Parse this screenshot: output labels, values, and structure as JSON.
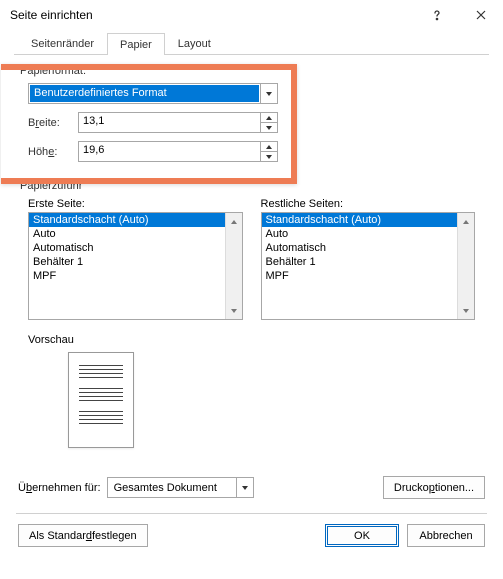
{
  "window": {
    "title": "Seite einrichten"
  },
  "tabs": {
    "margins": "Seitenränder",
    "paper": "Papier",
    "layout": "Layout"
  },
  "paperformat": {
    "label": "Papierformat:",
    "value": "Benutzerdefiniertes Format",
    "width_label_pre": "B",
    "width_label_und": "r",
    "width_label_post": "eite:",
    "width_value": "13,1",
    "height_pre": "Höh",
    "height_und": "e",
    "height_post": ":",
    "height_value": "19,6"
  },
  "papierzufuhr": {
    "label": "Papierzufuhr",
    "first_label_und": "E",
    "first_label_post": "rste Seite:",
    "other_label_und": "R",
    "other_label_post": "estliche Seiten:",
    "first_items": [
      "Standardschacht (Auto)",
      "Auto",
      "Automatisch",
      "Behälter 1",
      "MPF"
    ],
    "other_items": [
      "Standardschacht (Auto)",
      "Auto",
      "Automatisch",
      "Behälter 1",
      "MPF"
    ]
  },
  "preview": {
    "label": "Vorschau"
  },
  "apply": {
    "pre": "Ü",
    "und": "b",
    "post": "ernehmen für:",
    "value": "Gesamtes Dokument"
  },
  "buttons": {
    "printoptions_pre": "Drucko",
    "printoptions_und": "p",
    "printoptions_post": "tionen...",
    "setdefault_pre": "Als Standar",
    "setdefault_und": "d",
    "setdefault_post": " festlegen",
    "ok": "OK",
    "cancel": "Abbrechen"
  }
}
